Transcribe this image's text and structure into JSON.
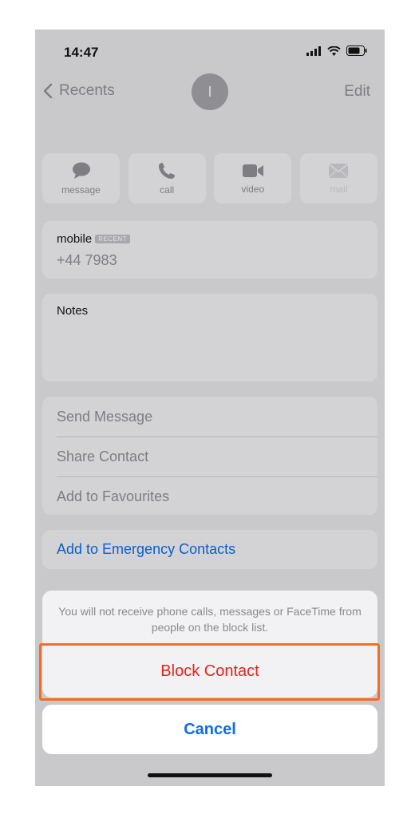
{
  "status": {
    "time": "14:47"
  },
  "nav": {
    "back_label": "Recents",
    "avatar_initial": "I",
    "edit_label": "Edit"
  },
  "actions": [
    {
      "label": "message",
      "icon": "message-icon",
      "enabled": true
    },
    {
      "label": "call",
      "icon": "phone-icon",
      "enabled": true
    },
    {
      "label": "video",
      "icon": "video-icon",
      "enabled": true
    },
    {
      "label": "mail",
      "icon": "mail-icon",
      "enabled": false
    }
  ],
  "phone": {
    "label": "mobile",
    "badge": "RECENT",
    "number": "+44 7983"
  },
  "notes": {
    "label": "Notes"
  },
  "options": [
    "Send Message",
    "Share Contact",
    "Add to Favourites"
  ],
  "emergency": {
    "label": "Add to Emergency Contacts"
  },
  "sheet": {
    "message": "You will not receive phone calls, messages or FaceTime from people on the block list.",
    "block_label": "Block Contact",
    "cancel_label": "Cancel"
  },
  "colors": {
    "destructive": "#e5231c",
    "link": "#0b6fe8",
    "highlight": "#f36d22"
  }
}
